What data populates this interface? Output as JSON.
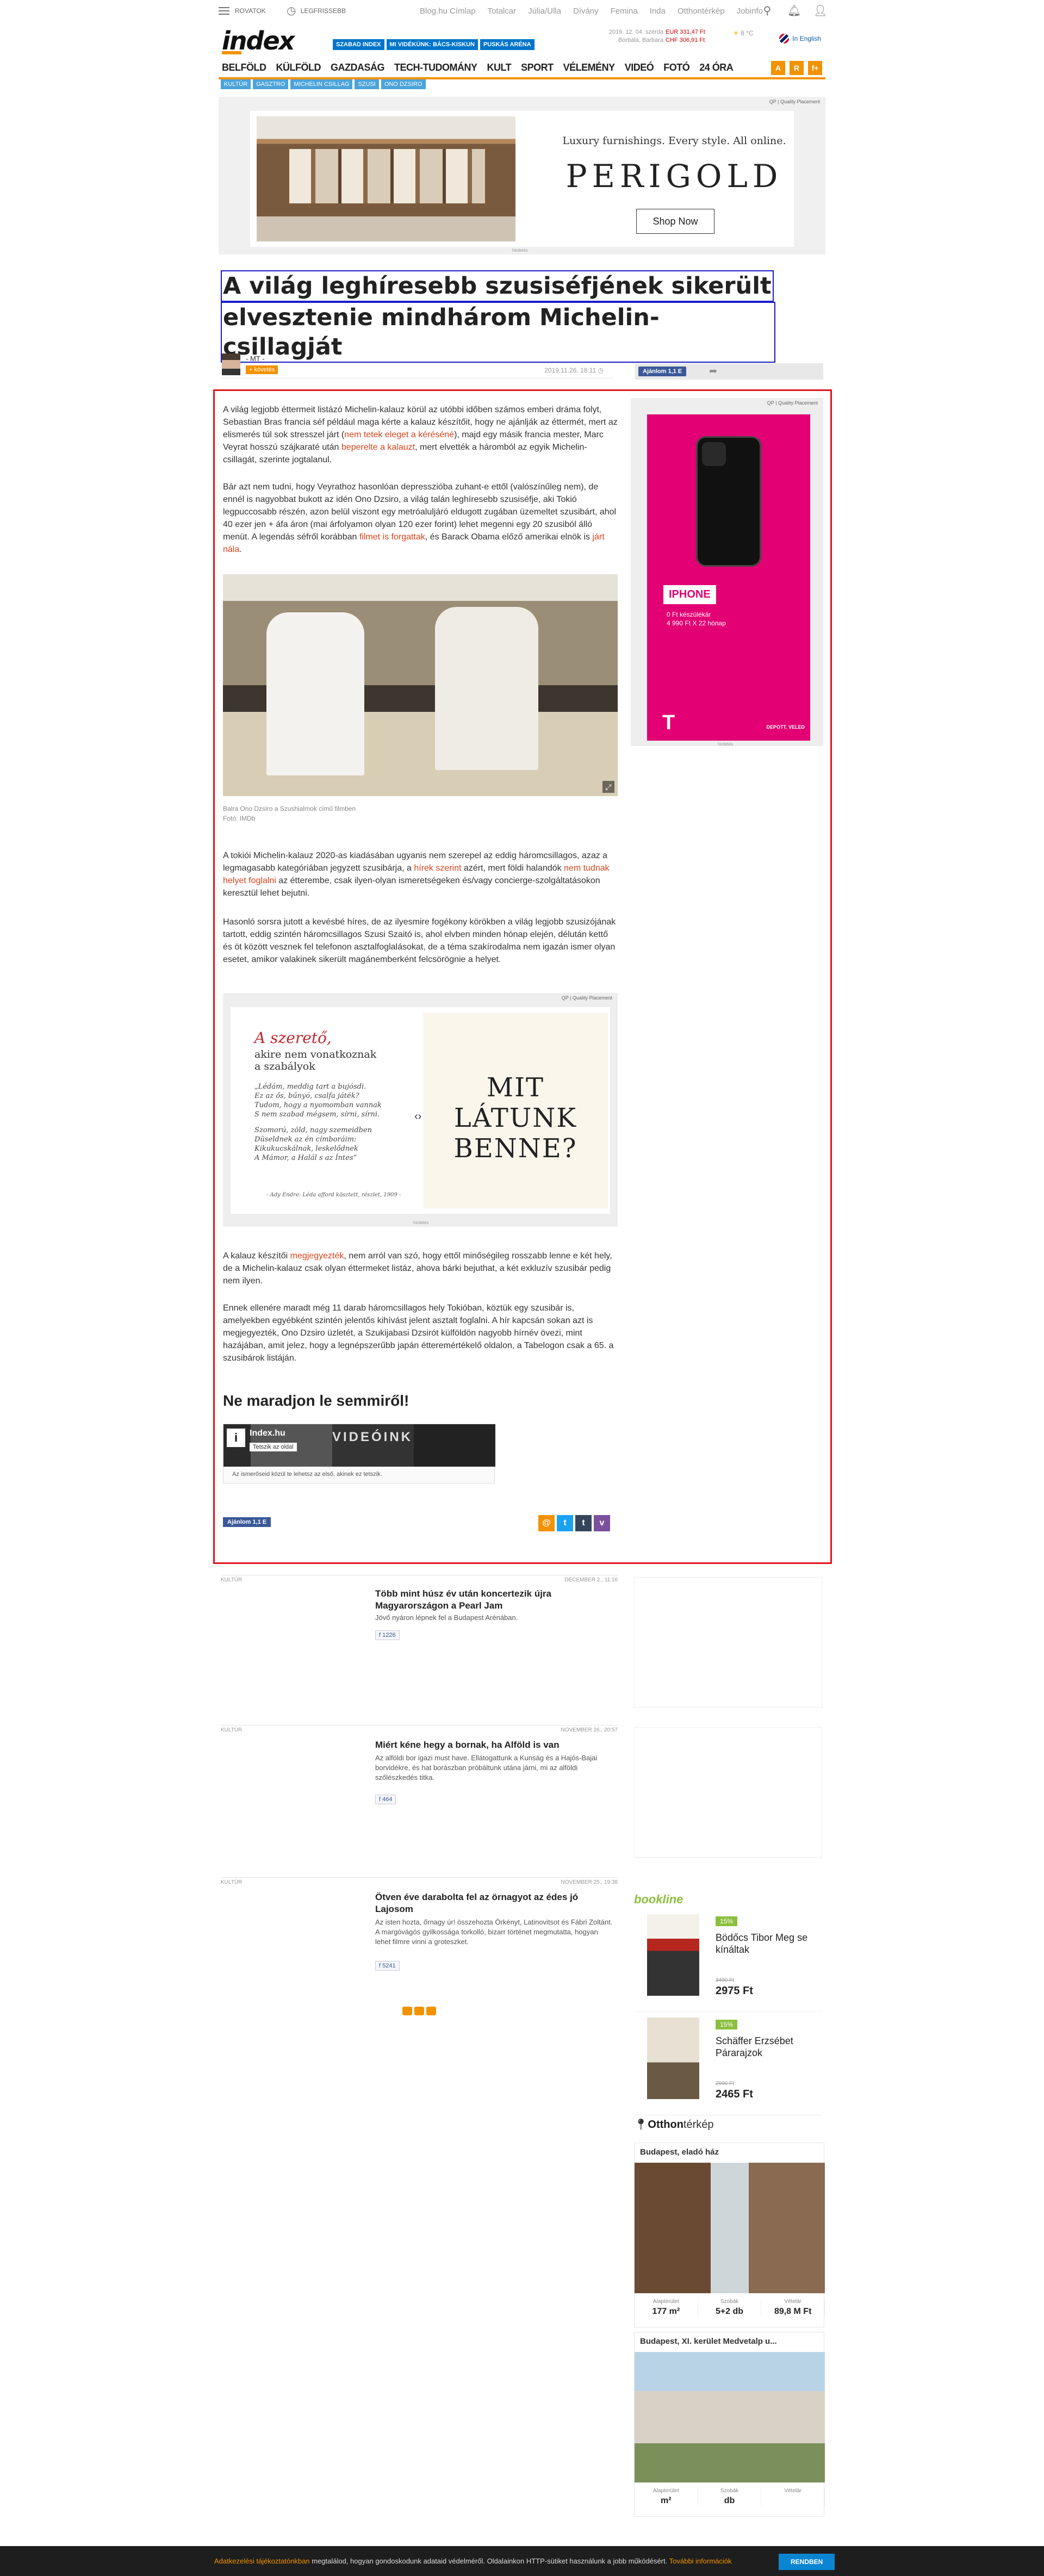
{
  "topbar": {
    "rovatok": "ROVATOK",
    "legfrissebb": "LEGFRISSEBB",
    "links": [
      "Blog.hu Címlap",
      "Totalcar",
      "Júlia/Ulla",
      "Dívány",
      "Femina",
      "Inda",
      "Otthontérkép",
      "Jobinfo"
    ]
  },
  "header": {
    "logo": "index",
    "promo_tags": [
      "SZABAD INDEX",
      "MI VIDÉKÜNK: BÁCS-KISKUN",
      "PUSKÁS ARÉNA"
    ],
    "date_line1": "2019. 12. 04. szerda",
    "date_line2": "Borbála, Barbara",
    "fx_line1": "EUR 331,47 Ft",
    "fx_line2": "CHF 306,91 Ft",
    "weather": "8 °C",
    "english": "In English"
  },
  "nav": {
    "items": [
      "BELFÖLD",
      "KÜLFÖLD",
      "GAZDASÁG",
      "TECH-TUDOMÁNY",
      "KULT",
      "SPORT",
      "VÉLEMÉNY",
      "VIDEÓ",
      "FOTÓ",
      "24 ÓRA"
    ],
    "icons": [
      "A",
      "R",
      "f+"
    ]
  },
  "subtags": [
    "KULTÚR",
    "GASZTRO",
    "MICHELIN CSILLAG",
    "SZUSI",
    "ONO DZSIRO"
  ],
  "top_ad": {
    "quality": "QP | Quality Placement",
    "tagline": "Luxury furnishings. Every style. All online.",
    "brand": "PERIGOLD",
    "button": "Shop Now",
    "label": "hirdetés"
  },
  "article": {
    "title_line1": "A világ leghíresebb szusiséfjének sikerült",
    "title_line2": "elvesztenie mindhárom Michelin-csillagját",
    "author": "- MT -",
    "follow": "követés",
    "datetime": "2019.11.26. 18:11",
    "fb_button": "Ajánlom 1,1 E",
    "p1_a": "A világ legjobb éttermeit listázó Michelin-kalauz körül az utóbbi időben számos emberi dráma folyt, Sebastian Bras francia séf például maga kérte a kalauz készítőit, hogy ne ajánlják az éttermét, mert az elismerés túl sok stresszel járt (",
    "p1_link1": "nem tetek eleget a kéréséné",
    "p1_b": "), majd egy másik francia mester, Marc Veyrat hosszú szájkaraté után ",
    "p1_link2": "beperelte a kalauzt",
    "p1_c": ", mert elvették a háromból az egyik Michelin-csillagát, szerinte jogtalanul.",
    "p2_a": "Bár azt nem tudni, hogy Veyrathoz hasonlóan depresszióba zuhant-e ettől (valószínűleg nem), de ennél is nagyobbat bukott az idén Ono Dzsiro, a világ talán leghíresebb szusiséfje, aki Tokió legpuccosabb részén, azon belül viszont egy metróaluljáró eldugott zugában üzemeltet szusibárt, ahol 40 ezer jen + áfa áron (mai árfolyamon olyan 120 ezer forint) lehet megenni egy 20 szusiból álló menüt. A legendás séfről korábban ",
    "p2_link": "filmet is forgattak",
    "p2_b": ", és Barack Obama előző amerikai elnök is ",
    "p2_link2": "járt nála",
    "p2_c": ".",
    "caption1": "Balra Ono Dzsiro a Szushialmok című filmben",
    "caption2": "Fotó: IMDb",
    "p3_a": "A tokiói Michelin-kalauz 2020-as kiadásában ugyanis nem szerepel az eddig háromcsillagos, azaz a legmagasabb kategóriában jegyzett szusibárja, a ",
    "p3_link1": "hírek szerint",
    "p3_b": " azért, mert földi halandók ",
    "p3_link2": "nem tudnak helyet foglalni",
    "p3_c": " az étterembe, csak ilyen-olyan ismeretségeken és/vagy concierge-szolgáltatásokon keresztül lehet bejutni.",
    "p4": "Hasonló sorsra jutott a kevésbé híres, de az ilyesmire fogékony körökben a világ legjobb szusizójának tartott, eddig szintén háromcsillagos Szusi Szaitó is, ahol elvben minden hónap elején, délután kettő és öt között vesznek fel telefonon asztalfoglalásokat, de a téma szakírodalma nem igazán ismer olyan esetet, amikor valakinek sikerült magánemberként felcsörögnie a helyet.",
    "p5_a": "A kalauz készítői ",
    "p5_link": "megjegyezték",
    "p5_b": ", nem arról van szó, hogy ettől minőségileg rosszabb lenne e két hely, de a Michelin-kalauz csak olyan éttermeket listáz, ahova bárki bejuthat, a két exkluzív szusibár pedig nem ilyen.",
    "p6": "Ennek ellenére maradt még 11 darab háromcsillagos hely Tokióban, köztük egy szusibár is, amelyekben egyébként szintén jelentős kihívást jelent asztalt foglalni. A hír kapcsán sokan azt is megjegyezték, Ono Dzsiro üzletét, a Szukijabasi Dzsirót külföldön nagyobb hírnév övezi, mint hazájában, amit jelez, hogy a legnépszerűbb japán étteremértékelő oldalon, a Tabelogon csak a 65. a szusibárok listáján."
  },
  "mid_ad": {
    "quality": "QP | Quality Placement",
    "heading": "A szerető,",
    "sub1": "akire nem vonatkoznak",
    "sub2": "a szabályok",
    "poem": [
      "„Lédám, meddig tart a bujósdi.",
      "Ez az ős, bűnyó, csalfa játék?",
      "Tudom, hogy a nyomomban vannak",
      "S nem szabad mégsem, sírni, sírni.",
      "",
      "Szomorú, zöld, nagy szemeidben",
      "Düseldnek az én címboráim:",
      "Kikukucskálnak, leskelődnek",
      "A Mámor, a Halál s az Íntes”"
    ],
    "poem_src": "- Ady Endre: Léda afford kösztett, részlet, 1909 -",
    "right_text": "MIT LÁTUNK BENNE?",
    "label": "hirdetés"
  },
  "right_ad": {
    "quality": "QP | Quality Placement",
    "product": "IPHONE",
    "line1": "0 Ft készülékár",
    "line2": "4 990 Ft X 22 hónap",
    "brand": "T",
    "slogan": "DEPOTT. VELED",
    "label": "hirdetés"
  },
  "ne_maradjon": {
    "heading": "Ne maradjon le semmiről!",
    "fb_page": "Index.hu",
    "fb_follow": "Tetszik az oldal",
    "fb_banner": "VIDEÓINK",
    "fb_line": "Az ismerőseid közül te lehetsz az első, akinek ez tetszik."
  },
  "footer_share": {
    "fb": "Ajánlom 1,1 E",
    "icons": [
      "@",
      "t",
      "t",
      "v"
    ]
  },
  "related": [
    {
      "cat": "KULTÚR",
      "date": "DECEMBER 2., 11:16",
      "title": "Több mint húsz év után koncertezik újra Magyarországon a Pearl Jam",
      "lead": "Jövő nyáron lépnek fel a Budapest Arénában.",
      "fb": "1226"
    },
    {
      "cat": "KULTÚR",
      "date": "NOVEMBER 26., 20:57",
      "title": "Miért kéne hegy a bornak, ha Alföld is van",
      "lead": "Az alföldi bor igazi must have. Ellátogattunk a Kunság és a Hajós-Bajai borvidékre, és hat borászban próbáltunk utána járni, mi az alföldi szőlészkedés titka.",
      "fb": "464"
    },
    {
      "cat": "KULTÚR",
      "date": "NOVEMBER 25., 19:38",
      "title": "Ötven éve darabolta fel az örnagyot az édes jó Lajosom",
      "lead": "Az isten hozta, őrnagy úr! összehozta Örkényt, Latinovitsot és Fábri Zoltánt. A margóvágós gyilkossága torkolló, bizarr történet megmutatta, hogyan lehet filmre vinni a groteszket.",
      "fb": "5241"
    }
  ],
  "bookline": {
    "logo": "bookline",
    "books": [
      {
        "discount": "15%",
        "title": "Bödőcs Tibor Meg se kínáltak",
        "old": "3490 Ft",
        "price": "2975 Ft"
      },
      {
        "discount": "15%",
        "title": "Schäffer Erzsébet Párarajzok",
        "old": "2990 Ft",
        "price": "2465 Ft"
      }
    ]
  },
  "otthon": {
    "logo_bold": "Otthon",
    "logo_rest": "térkép",
    "props": [
      {
        "title": "Budapest, eladó ház",
        "area_lbl": "Alapterület",
        "area": "177 m²",
        "rooms_lbl": "Szobák",
        "rooms": "5+2 db",
        "price_lbl": "Vételár",
        "price": "89,8 M Ft"
      },
      {
        "title": "Budapest, XI. kerület Medvetalp u...",
        "area_lbl": "Alapterület",
        "area": "m²",
        "rooms_lbl": "Szobák",
        "rooms": "db",
        "price_lbl": "Vételár",
        "price": ""
      }
    ]
  },
  "cookie": {
    "link1": "Adatkezelési tájékoztatónkban",
    "text": " megtalálod, hogyan gondoskodunk adataid védelméről. Oldalainkon HTTP-sütiket használunk a jobb működésért. ",
    "link2": "További információk",
    "button": "RENDBEN"
  },
  "colors": {
    "accent": "#f39200",
    "frame": "#e0141e",
    "link": "#d9441c",
    "tmobile": "#e20074",
    "bookline": "#8cbf3f"
  }
}
